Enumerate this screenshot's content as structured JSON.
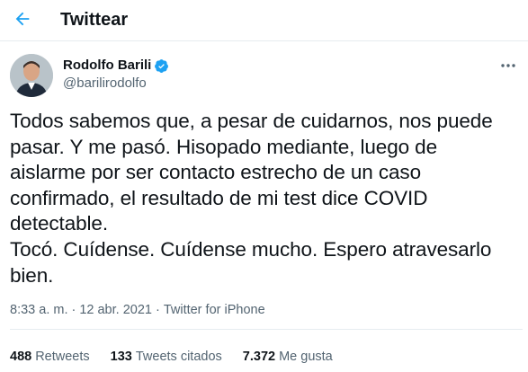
{
  "header": {
    "title": "Twittear",
    "back_icon": "arrow-left-icon",
    "accent_color": "#1da1f2"
  },
  "tweet": {
    "author_name": "Rodolfo Barili",
    "author_handle": "@barilirodolfo",
    "verified": true,
    "verified_icon": "verified-badge-icon",
    "more_icon": "more-horizontal-icon",
    "text": "Todos sabemos que, a pesar de cuidarnos, nos puede\npasar. Y me pasó. Hisopado mediante, luego de\naislarme por ser contacto estrecho de un caso\nconfirmado, el resultado de mi test dice COVID\ndetectable.\nTocó. Cuídense. Cuídense mucho. Espero atravesarlo\nbien.",
    "time": "8:33 a. m.",
    "date": "12 abr. 2021",
    "source": "Twitter for iPhone",
    "separator": "·"
  },
  "stats": {
    "retweets_count": "488",
    "retweets_label": "Retweets",
    "quotes_count": "133",
    "quotes_label": "Tweets citados",
    "likes_count": "7.372",
    "likes_label": "Me gusta"
  }
}
